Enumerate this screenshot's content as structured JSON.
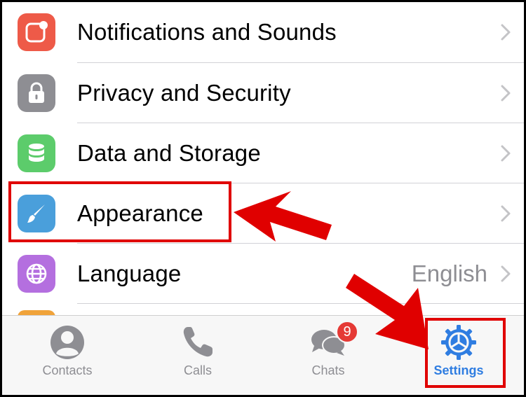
{
  "settings_list": {
    "items": [
      {
        "label": "Notifications and Sounds",
        "icon": "notification-badge-icon",
        "color": "#ee5a48",
        "value": ""
      },
      {
        "label": "Privacy and Security",
        "icon": "lock-icon",
        "color": "#8e8e93",
        "value": ""
      },
      {
        "label": "Data and Storage",
        "icon": "database-icon",
        "color": "#5ccc6b",
        "value": ""
      },
      {
        "label": "Appearance",
        "icon": "paintbrush-icon",
        "color": "#4a9fdb",
        "value": ""
      },
      {
        "label": "Language",
        "icon": "globe-icon",
        "color": "#b46fdf",
        "value": "English"
      }
    ]
  },
  "tab_bar": {
    "tabs": [
      {
        "label": "Contacts",
        "icon": "person-icon",
        "active": false
      },
      {
        "label": "Calls",
        "icon": "phone-icon",
        "active": false
      },
      {
        "label": "Chats",
        "icon": "chat-bubbles-icon",
        "active": false,
        "badge": "9"
      },
      {
        "label": "Settings",
        "icon": "gear-icon",
        "active": true
      }
    ]
  },
  "colors": {
    "accent": "#2f7de1",
    "annotation_red": "#e00000",
    "badge_red": "#e53935"
  }
}
